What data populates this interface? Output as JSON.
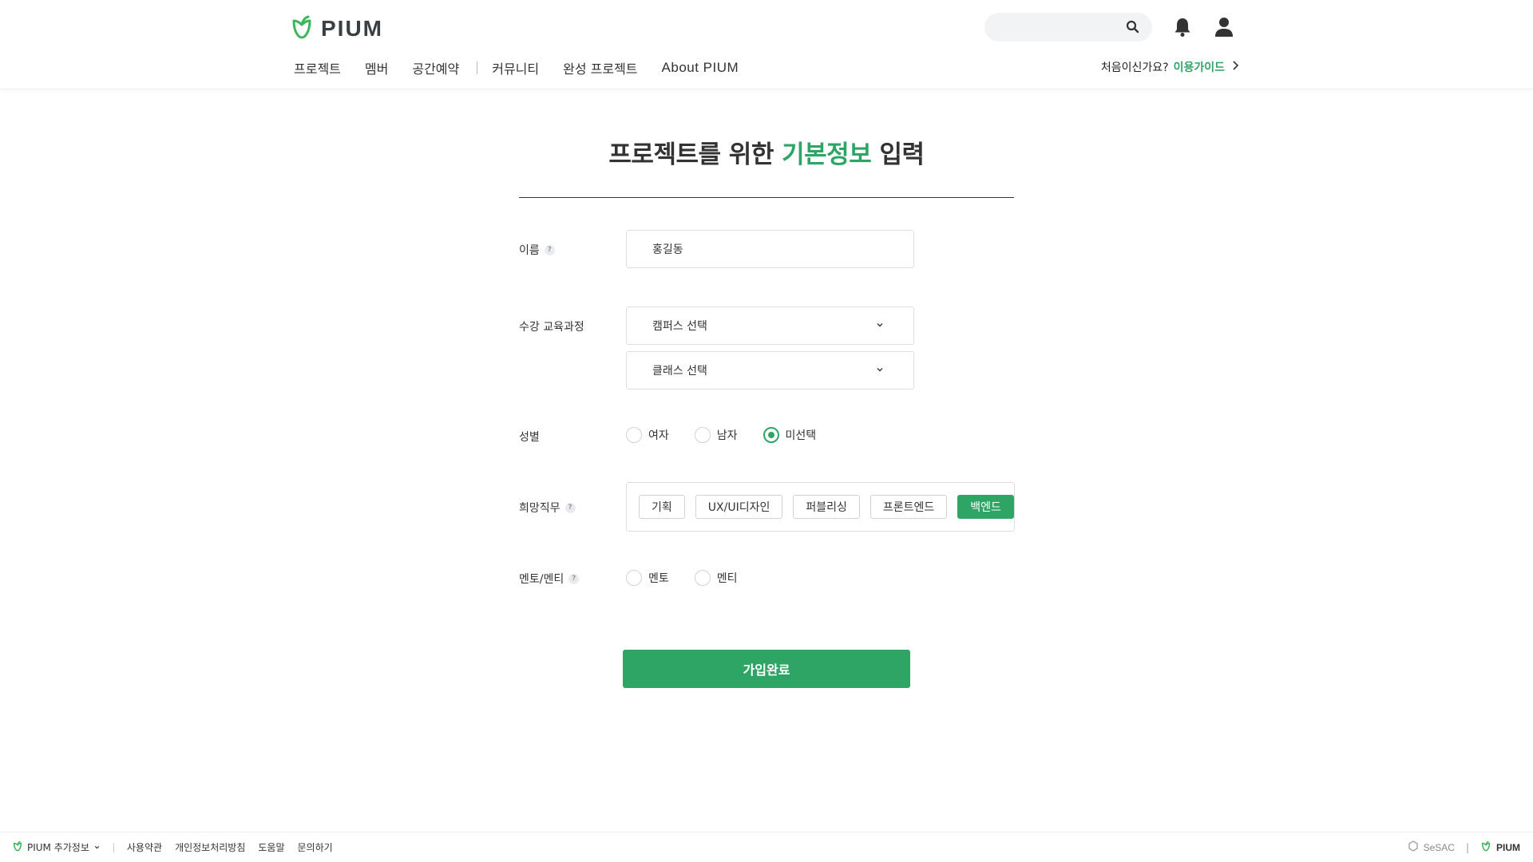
{
  "header": {
    "logo_text": "PIUM",
    "search_placeholder": "",
    "nav": [
      "프로젝트",
      "멤버",
      "공간예약",
      "커뮤니티",
      "완성 프로젝트",
      "About PIUM"
    ],
    "guide_prompt": "처음이신가요?",
    "guide_link": "이용가이드"
  },
  "form": {
    "title_prefix": "프로젝트를 위한 ",
    "title_accent": "기본정보",
    "title_suffix": " 입력",
    "name_label": "이름",
    "name_value": "홍길동",
    "course_label": "수강 교육과정",
    "campus_select": "캠퍼스 선택",
    "class_select": "클래스 선택",
    "gender_label": "성별",
    "gender_options": [
      "여자",
      "남자",
      "미선택"
    ],
    "gender_selected": "미선택",
    "job_label": "희망직무",
    "job_options": [
      "기획",
      "UX/UI디자인",
      "퍼블리싱",
      "프론트엔드",
      "백엔드"
    ],
    "job_selected": "백엔드",
    "mentor_label": "멘토/멘티",
    "mentor_options": [
      "멘토",
      "멘티"
    ],
    "help_glyph": "?",
    "submit_label": "가입완료"
  },
  "footer": {
    "info_label": "PIUM 추가정보",
    "links": [
      "사용약관",
      "개인정보처리방침",
      "도움말",
      "문의하기"
    ],
    "partner": "SeSAC",
    "divider": "|",
    "brand": "PIUM"
  },
  "colors": {
    "accent": "#2ea565",
    "text": "#333333",
    "border": "#dcdfe2"
  },
  "icons": [
    "leaf-logo-icon",
    "search-icon",
    "bell-icon",
    "user-icon",
    "chevron-right-icon",
    "chevron-down-icon",
    "help-icon",
    "sesac-logo-icon"
  ]
}
